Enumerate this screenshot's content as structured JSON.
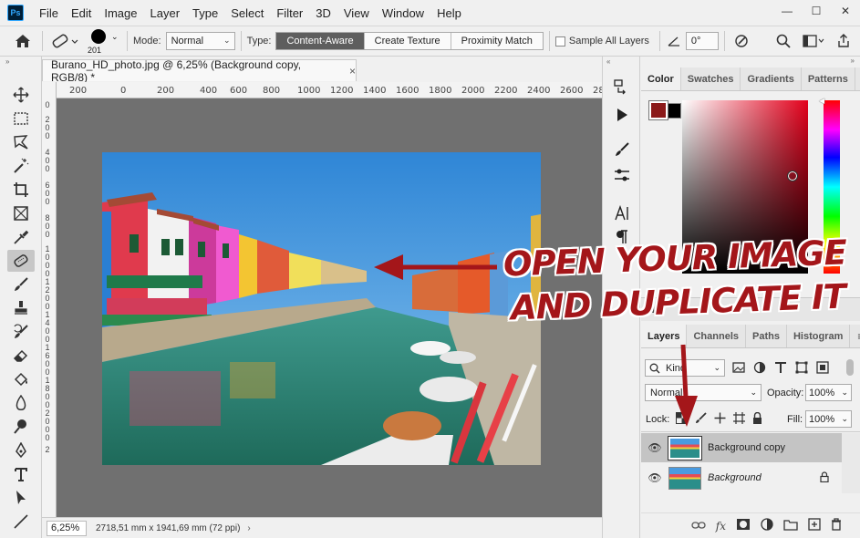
{
  "app": {
    "logo": "Ps"
  },
  "menubar": {
    "items": [
      "File",
      "Edit",
      "Image",
      "Layer",
      "Type",
      "Select",
      "Filter",
      "3D",
      "View",
      "Window",
      "Help"
    ]
  },
  "window_controls": {
    "minimize": "—",
    "maximize": "☐",
    "close": "✕"
  },
  "options": {
    "brush_size": "201",
    "mode_label": "Mode:",
    "mode_value": "Normal",
    "type_label": "Type:",
    "type_buttons": [
      "Content-Aware",
      "Create Texture",
      "Proximity Match"
    ],
    "type_active": "Content-Aware",
    "sample_all_layers": "Sample All Layers",
    "angle_value": "0°"
  },
  "document": {
    "tab_title": "Burano_HD_photo.jpg @ 6,25% (Background copy, RGB/8) *",
    "close": "×",
    "ruler_top": [
      "200",
      "0",
      "200",
      "400",
      "600",
      "800",
      "1000",
      "1200",
      "1400",
      "1600",
      "1800",
      "2000",
      "2200",
      "2400",
      "2600",
      "2800"
    ],
    "ruler_left": [
      "0",
      "2\n0\n0",
      "4\n0\n0",
      "6\n0\n0",
      "8\n0\n0",
      "1\n0\n0\n0",
      "1\n2\n0\n0",
      "1\n4\n0\n0",
      "1\n6\n0\n0",
      "1\n8\n0\n0",
      "2\n0\n0\n0",
      "2"
    ],
    "zoom": "6,25%",
    "info": "2718,51 mm x 1941,69 mm (72 ppi)"
  },
  "color_panel": {
    "tabs": [
      "Color",
      "Swatches",
      "Gradients",
      "Patterns"
    ],
    "active": "Color",
    "foreground": "#8b1a1a",
    "background": "#000000"
  },
  "layers_panel": {
    "tabs": [
      "Layers",
      "Channels",
      "Paths",
      "Histogram"
    ],
    "active": "Layers",
    "kind_label": "Kind",
    "blend_mode": "Normal",
    "opacity_label": "Opacity:",
    "opacity_value": "100%",
    "lock_label": "Lock:",
    "fill_label": "Fill:",
    "fill_value": "100%",
    "layers": [
      {
        "name": "Background copy",
        "selected": true,
        "locked": false
      },
      {
        "name": "Background",
        "selected": false,
        "locked": true
      }
    ]
  },
  "annotation": {
    "line1": "OPEN YOUR IMAGE",
    "line2": "AND DUPLICATE IT",
    "arrow_color": "#a4161a"
  },
  "collapsed_panel_label": "N"
}
